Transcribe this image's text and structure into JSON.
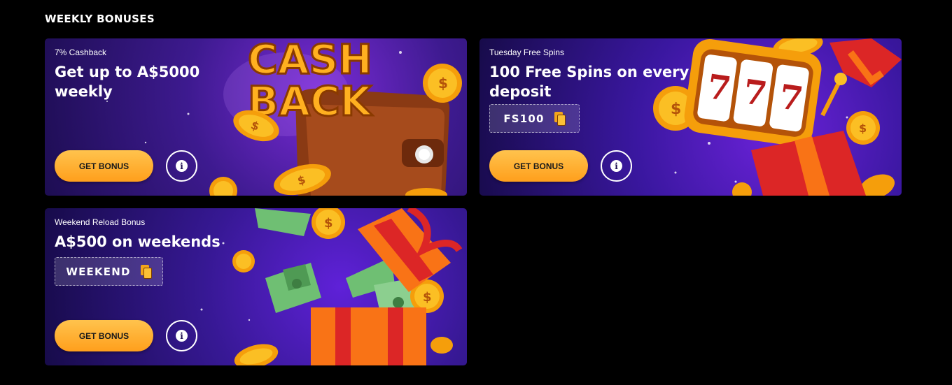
{
  "section": {
    "title": "WEEKLY BONUSES"
  },
  "cards": [
    {
      "eyebrow": "7% Cashback",
      "headline": "Get up to A$5000 weekly",
      "art_text": [
        "CASH",
        "BACK"
      ],
      "cta_label": "GET BONUS",
      "info_icon": "info-icon"
    },
    {
      "eyebrow": "Tuesday Free Spins",
      "headline": "100 Free Spins on every deposit",
      "promo_code": "FS100",
      "art_text": [
        "7",
        "7",
        "7"
      ],
      "cta_label": "GET BONUS",
      "info_icon": "info-icon"
    },
    {
      "eyebrow": "Weekend Reload Bonus",
      "headline": "A$500 on weekends",
      "promo_code": "WEEKEND",
      "cta_label": "GET BONUS",
      "info_icon": "info-icon"
    }
  ],
  "colors": {
    "accent": "#ff9f1c",
    "accent_light": "#ffc34d",
    "background": "#000000",
    "copy_icon": "#fbc036"
  }
}
